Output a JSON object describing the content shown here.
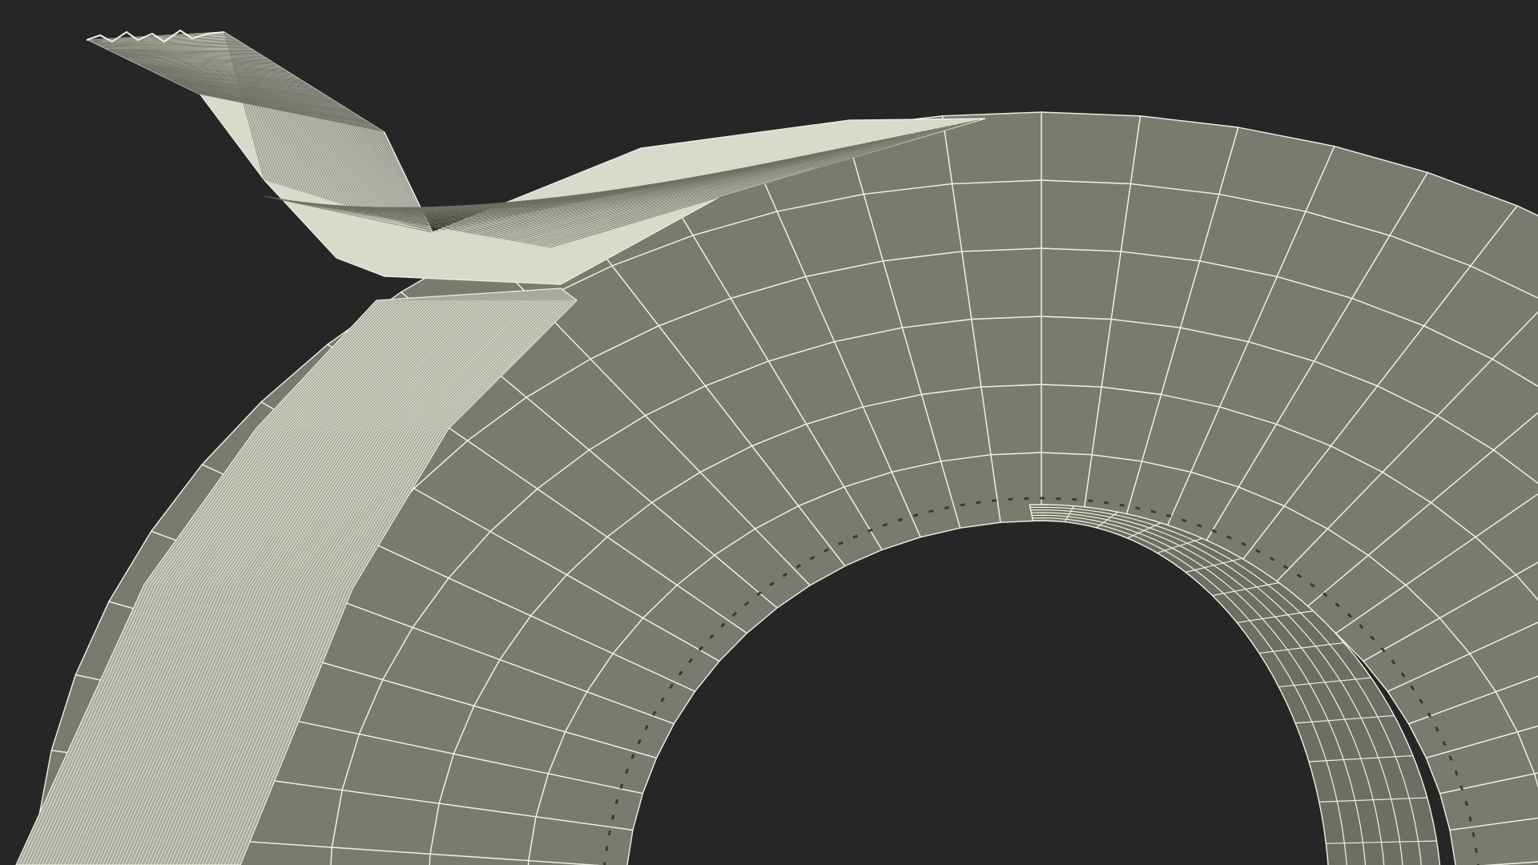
{
  "scene": {
    "subject": "tape-roll-wireframe",
    "background_color": "#262626",
    "surface_color": "#7a7b6e",
    "inner_surface_color": "#6e6f63",
    "wire_color": "#f2f2e4",
    "tape_strip_color": "#d9d9cc"
  }
}
